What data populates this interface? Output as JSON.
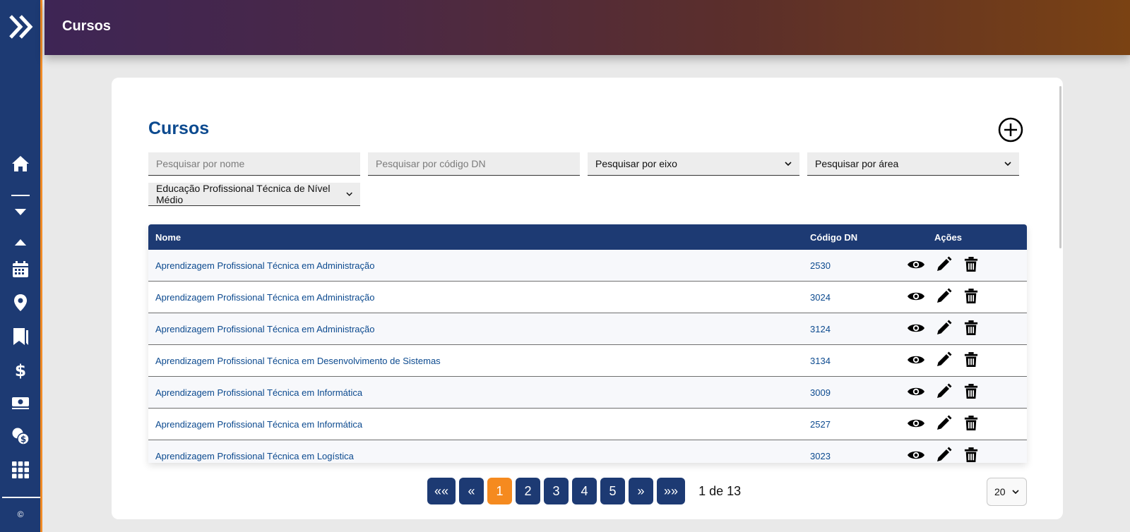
{
  "header": {
    "title": "Cursos"
  },
  "sidebar": {
    "copyright": "©",
    "items": [
      {
        "icon": "home-icon"
      },
      {
        "icon": "chevron-down-icon"
      },
      {
        "icon": "chevron-up-icon"
      },
      {
        "icon": "calendar-icon"
      },
      {
        "icon": "map-pin-icon"
      },
      {
        "icon": "bookmarks-icon"
      },
      {
        "icon": "dollar-icon"
      },
      {
        "icon": "money-icon"
      },
      {
        "icon": "coins-icon"
      },
      {
        "icon": "grid-icon"
      }
    ]
  },
  "page": {
    "title": "Cursos",
    "filters": {
      "name_placeholder": "Pesquisar por nome",
      "code_placeholder": "Pesquisar por código DN",
      "eixo_selected": "Pesquisar por eixo",
      "area_selected": "Pesquisar por área",
      "modalidade_selected": "Educação Profissional Técnica de Nível Médio"
    },
    "table": {
      "columns": [
        "Nome",
        "Código DN",
        "Ações"
      ],
      "rows": [
        {
          "nome": "Aprendizagem Profissional Técnica em Administração",
          "codigo": "2530"
        },
        {
          "nome": "Aprendizagem Profissional Técnica em Administração",
          "codigo": "3024"
        },
        {
          "nome": "Aprendizagem Profissional Técnica em Administração",
          "codigo": "3124"
        },
        {
          "nome": "Aprendizagem Profissional Técnica em Desenvolvimento de Sistemas",
          "codigo": "3134"
        },
        {
          "nome": "Aprendizagem Profissional Técnica em Informática",
          "codigo": "3009"
        },
        {
          "nome": "Aprendizagem Profissional Técnica em Informática",
          "codigo": "2527"
        },
        {
          "nome": "Aprendizagem Profissional Técnica em Logística",
          "codigo": "3023"
        }
      ]
    },
    "pagination": {
      "first": "««",
      "prev": "«",
      "pages": [
        "1",
        "2",
        "3",
        "4",
        "5"
      ],
      "current": "1",
      "next": "»",
      "last": "»»",
      "info": "1 de 13",
      "per_page": "20"
    }
  },
  "colors": {
    "primary": "#1d3a73",
    "accent": "#f58a1f",
    "title": "#0c4a8f"
  }
}
